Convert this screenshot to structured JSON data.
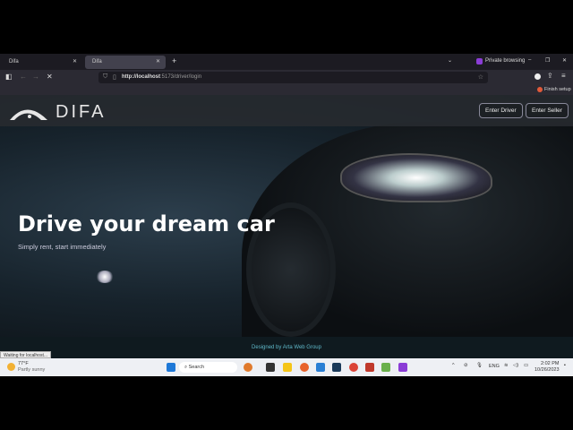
{
  "browser": {
    "tabs": [
      {
        "title": "Difa",
        "active": false
      },
      {
        "title": "Difa",
        "active": true
      }
    ],
    "new_tab": "+",
    "private": "Private browsing",
    "url_host": "http://localhost",
    "url_rest": ":5173/driver/login",
    "finish_setup": "Finish setup",
    "status": "Waiting for localhost..."
  },
  "site": {
    "logo": "DIFA",
    "buttons": {
      "driver": "Enter Driver",
      "seller": "Enter Seller"
    },
    "hero_title": "Drive your dream car",
    "hero_subtitle": "Simply rent, start immediately",
    "footer": "Designed by Arta Web Group"
  },
  "taskbar": {
    "weather_temp": "77°F",
    "weather_desc": "Partly sunny",
    "search": "Search",
    "lang": "ENG",
    "time": "2:02 PM",
    "date": "10/26/2023"
  }
}
